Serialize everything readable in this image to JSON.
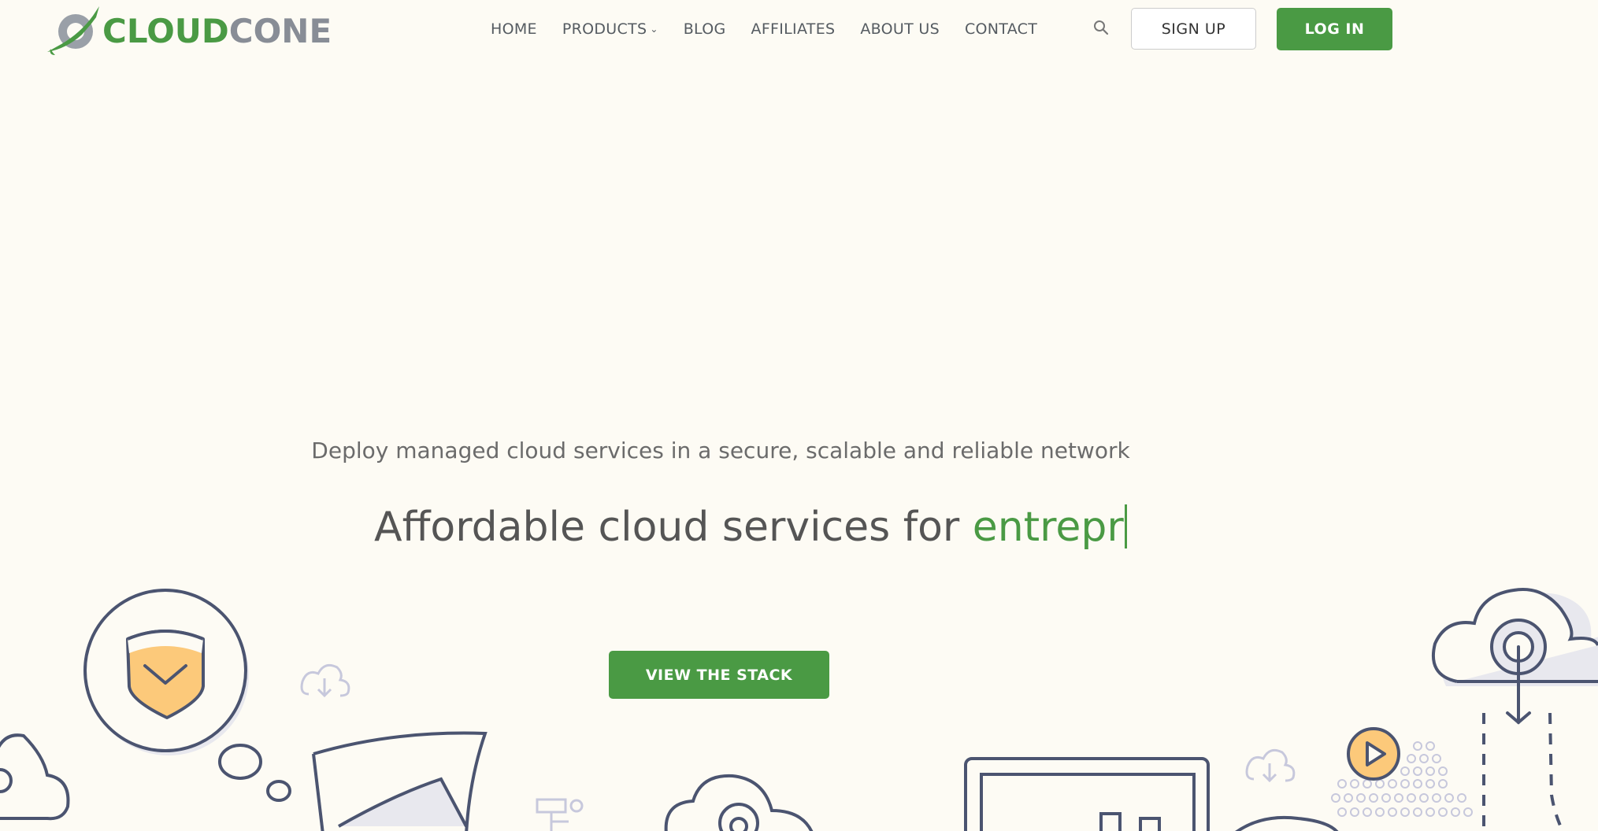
{
  "brand": {
    "name_part1": "CLOUD",
    "name_part2": "CONE",
    "green": "#4a9a44",
    "gray": "#888d96"
  },
  "nav": {
    "items": [
      {
        "label": "HOME"
      },
      {
        "label": "PRODUCTS",
        "has_dropdown": true
      },
      {
        "label": "BLOG"
      },
      {
        "label": "AFFILIATES"
      },
      {
        "label": "ABOUT US"
      },
      {
        "label": "CONTACT"
      }
    ],
    "search_icon": "search-icon",
    "signup_label": "SIGN UP",
    "login_label": "LOG IN"
  },
  "hero": {
    "subtitle": "Deploy managed cloud services in a secure, scalable and reliable network",
    "title_static": "Affordable cloud services for ",
    "title_typed": "entrepr",
    "cta_label": "VIEW THE STACK"
  },
  "colors": {
    "background": "#fdfbf4",
    "accent": "#4a9a44",
    "line_art": "#4b5470",
    "highlight": "#fcc97a"
  }
}
